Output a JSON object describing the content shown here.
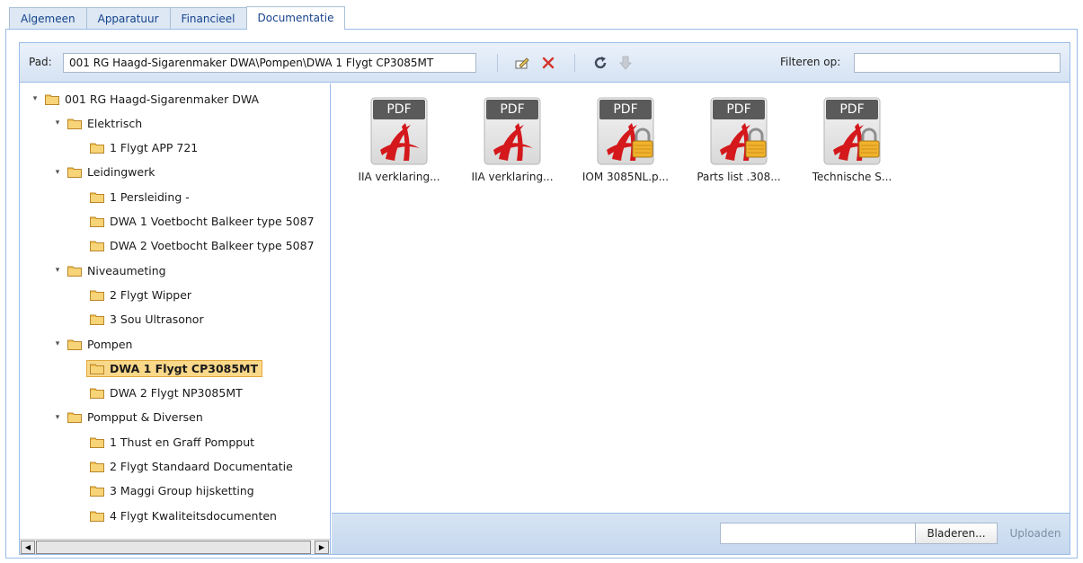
{
  "tabs": [
    {
      "label": "Algemeen",
      "active": false
    },
    {
      "label": "Apparatuur",
      "active": false
    },
    {
      "label": "Financieel",
      "active": false
    },
    {
      "label": "Documentatie",
      "active": true
    }
  ],
  "toolbar": {
    "path_label": "Pad:",
    "path_value": "001 RG Haagd-Sigarenmaker DWA\\Pompen\\DWA 1 Flygt CP3085MT",
    "icons": [
      "edit-icon",
      "delete-icon",
      "refresh-icon",
      "download-icon"
    ],
    "filter_label": "Filteren op:",
    "filter_value": ""
  },
  "tree": {
    "nodes": [
      {
        "label": "001 RG Haagd-Sigarenmaker DWA",
        "level": 0,
        "expanded": true
      },
      {
        "label": "Elektrisch",
        "level": 1,
        "expanded": true
      },
      {
        "label": "1 Flygt APP 721",
        "level": 2
      },
      {
        "label": "Leidingwerk",
        "level": 1,
        "expanded": true
      },
      {
        "label": "1 Persleiding -",
        "level": 2
      },
      {
        "label": "DWA 1 Voetbocht Balkeer type 5087",
        "level": 2
      },
      {
        "label": "DWA 2 Voetbocht Balkeer type 5087",
        "level": 2
      },
      {
        "label": "Niveaumeting",
        "level": 1,
        "expanded": true
      },
      {
        "label": "2 Flygt Wipper",
        "level": 2
      },
      {
        "label": "3 Sou Ultrasonor",
        "level": 2
      },
      {
        "label": "Pompen",
        "level": 1,
        "expanded": true
      },
      {
        "label": "DWA 1 Flygt CP3085MT",
        "level": 2,
        "selected": true
      },
      {
        "label": "DWA 2 Flygt NP3085MT",
        "level": 2
      },
      {
        "label": "Pompput & Diversen",
        "level": 1,
        "expanded": true
      },
      {
        "label": "1 Thust en Graff Pompput",
        "level": 2
      },
      {
        "label": "2 Flygt Standaard Documentatie",
        "level": 2
      },
      {
        "label": "3 Maggi Group hijsketting",
        "level": 2
      },
      {
        "label": "4 Flygt Kwaliteitsdocumenten",
        "level": 2
      }
    ]
  },
  "files": [
    {
      "name": "IIA verklaring...",
      "badge": "PDF",
      "locked": false
    },
    {
      "name": "IIA verklaring...",
      "badge": "PDF",
      "locked": false
    },
    {
      "name": "IOM 3085NL.p...",
      "badge": "PDF",
      "locked": true
    },
    {
      "name": "Parts list .308...",
      "badge": "PDF",
      "locked": true
    },
    {
      "name": "Technische S...",
      "badge": "PDF",
      "locked": true
    }
  ],
  "upload": {
    "file_value": "",
    "browse_label": "Bladeren...",
    "upload_label": "Uploaden"
  },
  "colors": {
    "accent": "#99bbe8",
    "selected_bg": "#f9d88a",
    "folder": "#f2c14e",
    "pdf_red": "#d4181b"
  }
}
